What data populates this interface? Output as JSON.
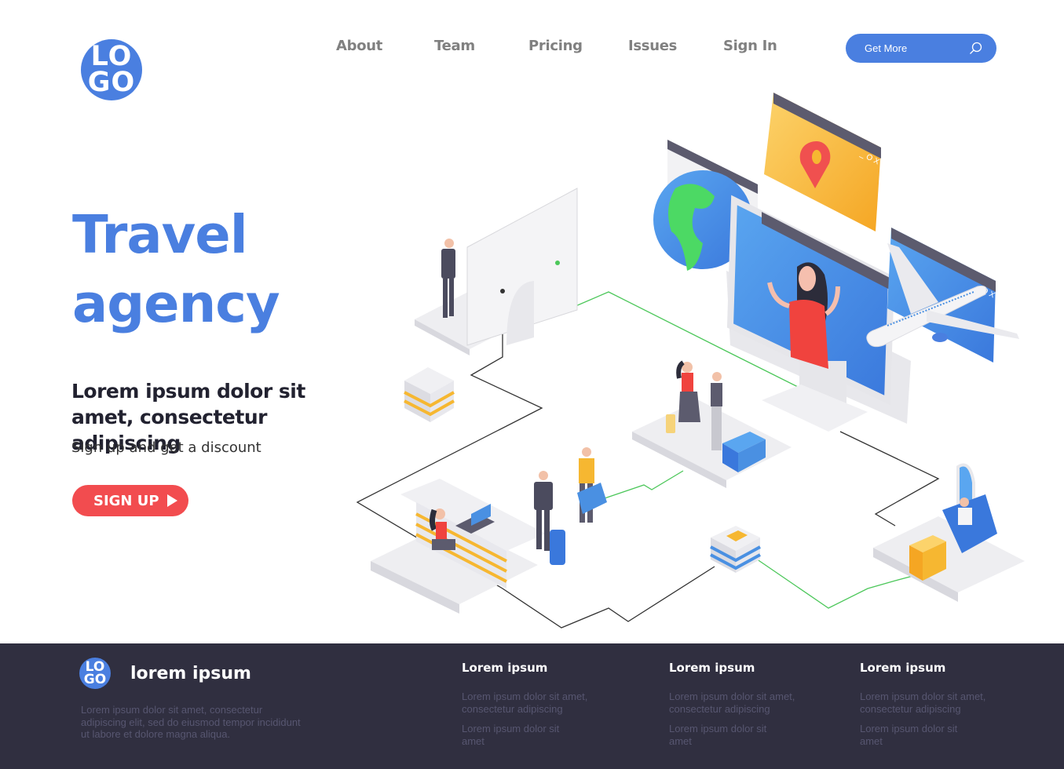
{
  "header": {
    "logo": {
      "line1": "LO",
      "line2": "GO"
    },
    "nav": [
      {
        "label": "About"
      },
      {
        "label": "Team"
      },
      {
        "label": "Pricing"
      },
      {
        "label": "Issues"
      },
      {
        "label": "Sign In"
      }
    ],
    "cta": {
      "label": "Get More",
      "icon": "search-icon"
    }
  },
  "hero": {
    "title_line1": "Travel",
    "title_line2": "agency",
    "subheading": "Lorem ipsum dolor sit amet, consectetur adipiscing",
    "subtext": "Sign up and get a discount",
    "signup_label": "SIGN UP",
    "signup_icon": "play-icon"
  },
  "illustration": {
    "description": "Isometric travel agency scene: monitor with video call, globe, map pin window, airplane, reception desk, travelers with luggage, airplane seat passenger, server stacks connected by lines",
    "window_controls": "_ O X"
  },
  "colors": {
    "brand_blue": "#4a7fe0",
    "cta_red": "#f24c4f",
    "footer_bg": "#302f40",
    "footer_muted": "#575670",
    "line_green": "#4cc75a",
    "accent_yellow": "#f6b731"
  },
  "footer": {
    "logo": {
      "line1": "LO",
      "line2": "GO"
    },
    "brand": "lorem ipsum",
    "description": "Lorem ipsum dolor sit amet, consectetur adipiscing elit, sed do eiusmod tempor incididunt ut labore et dolore magna aliqua.",
    "columns": [
      {
        "title": "Lorem ipsum",
        "links": [
          "Lorem ipsum dolor sit amet, consectetur adipiscing",
          "Lorem ipsum dolor sit amet"
        ]
      },
      {
        "title": "Lorem ipsum",
        "links": [
          "Lorem ipsum dolor sit amet, consectetur adipiscing",
          "Lorem ipsum dolor sit amet"
        ]
      },
      {
        "title": "Lorem ipsum",
        "links": [
          "Lorem ipsum dolor sit amet, consectetur adipiscing",
          "Lorem ipsum dolor sit amet"
        ]
      }
    ]
  }
}
